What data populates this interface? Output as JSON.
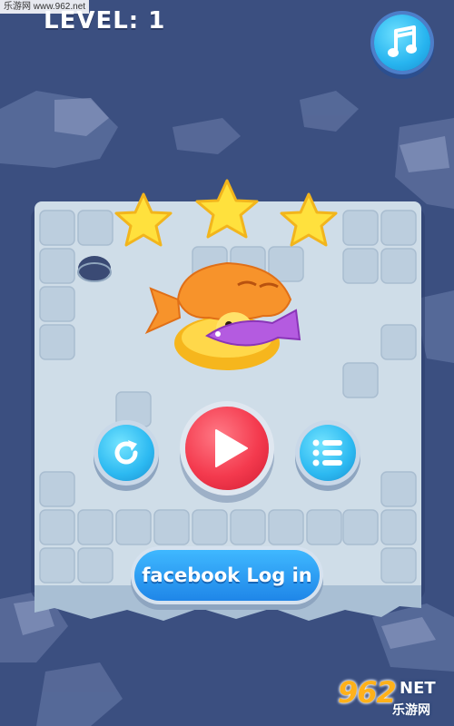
{
  "watermark_top": "乐游网 www.962.net",
  "level_label": "LEVEL: 1",
  "stars": {
    "earned": 3,
    "total": 3
  },
  "buttons": {
    "music": {
      "icon": "music-note-icon"
    },
    "restart": {
      "icon": "restart-icon"
    },
    "play": {
      "icon": "play-icon"
    },
    "menu": {
      "icon": "menu-list-icon"
    },
    "facebook_label": "facebook Log in"
  },
  "watermark_bottom": {
    "number": "962",
    "net": "NET",
    "site": "乐游网"
  },
  "colors": {
    "background": "#3b4f80",
    "board": "#cfdde8",
    "star": "#ffe13d",
    "play": "#f43a4e",
    "blue_button": "#2cb9f1",
    "facebook": "#1f86e8",
    "fish_orange": "#f7932b",
    "fish_purple": "#b45be0"
  }
}
